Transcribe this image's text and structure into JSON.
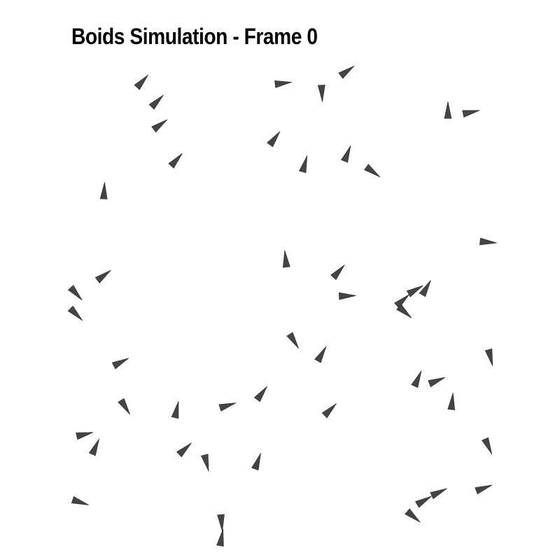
{
  "chart_data": {
    "type": "scatter",
    "title": "Boids Simulation - Frame 0",
    "xlabel": "",
    "ylabel": "",
    "xlim": [
      0,
      100
    ],
    "ylim": [
      0,
      100
    ],
    "axes_visible": false,
    "grid": false,
    "legend": "none",
    "marker": "triangle pointing along heading",
    "marker_color": "#3a3a3a",
    "boids": [
      {
        "x": 17.0,
        "y": 99.0,
        "heading": 48
      },
      {
        "x": 20.5,
        "y": 94.2,
        "heading": 45
      },
      {
        "x": 21.2,
        "y": 88.5,
        "heading": 36
      },
      {
        "x": 25.0,
        "y": 80.0,
        "heading": 48
      },
      {
        "x": 8.0,
        "y": 72.5,
        "heading": 87
      },
      {
        "x": 50.0,
        "y": 98.5,
        "heading": 7
      },
      {
        "x": 59.0,
        "y": 96.0,
        "heading": -87
      },
      {
        "x": 65.0,
        "y": 101.5,
        "heading": 36
      },
      {
        "x": 48.0,
        "y": 85.2,
        "heading": 53
      },
      {
        "x": 55.0,
        "y": 79.0,
        "heading": 74
      },
      {
        "x": 65.0,
        "y": 81.5,
        "heading": 68
      },
      {
        "x": 71.0,
        "y": 77.0,
        "heading": -36
      },
      {
        "x": 88.5,
        "y": 92.0,
        "heading": 90
      },
      {
        "x": 94.0,
        "y": 91.5,
        "heading": 12
      },
      {
        "x": 98.0,
        "y": 60.0,
        "heading": -5
      },
      {
        "x": 50.5,
        "y": 56.0,
        "heading": 96
      },
      {
        "x": 63.0,
        "y": 53.0,
        "heading": 48
      },
      {
        "x": 65.0,
        "y": 47.0,
        "heading": 2
      },
      {
        "x": 78.0,
        "y": 46.0,
        "heading": 42
      },
      {
        "x": 83.5,
        "y": 49.0,
        "heading": 60
      },
      {
        "x": 78.5,
        "y": 43.0,
        "heading": -41
      },
      {
        "x": 81.0,
        "y": 48.5,
        "heading": 30
      },
      {
        "x": 52.5,
        "y": 36.0,
        "heading": -58
      },
      {
        "x": 59.0,
        "y": 33.0,
        "heading": 60
      },
      {
        "x": 98.5,
        "y": 32.0,
        "heading": -76
      },
      {
        "x": 81.5,
        "y": 27.0,
        "heading": 66
      },
      {
        "x": 86.0,
        "y": 26.5,
        "heading": 22
      },
      {
        "x": 89.5,
        "y": 21.5,
        "heading": 84
      },
      {
        "x": 61.0,
        "y": 19.5,
        "heading": 45
      },
      {
        "x": 8.0,
        "y": 52.0,
        "heading": 37
      },
      {
        "x": 1.5,
        "y": 47.5,
        "heading": -48
      },
      {
        "x": 1.5,
        "y": 42.5,
        "heading": -45
      },
      {
        "x": 12.0,
        "y": 31.0,
        "heading": 27
      },
      {
        "x": 13.0,
        "y": 20.0,
        "heading": -58
      },
      {
        "x": 25.0,
        "y": 19.5,
        "heading": 78
      },
      {
        "x": 37.0,
        "y": 20.5,
        "heading": 17
      },
      {
        "x": 45.0,
        "y": 23.5,
        "heading": 53
      },
      {
        "x": 3.5,
        "y": 13.5,
        "heading": 13
      },
      {
        "x": 6.0,
        "y": 10.5,
        "heading": 66
      },
      {
        "x": 27.0,
        "y": 10.0,
        "heading": 43
      },
      {
        "x": 32.0,
        "y": 6.5,
        "heading": -76
      },
      {
        "x": 44.0,
        "y": 7.0,
        "heading": 70
      },
      {
        "x": 2.5,
        "y": -3.0,
        "heading": -18
      },
      {
        "x": 35.5,
        "y": -8.0,
        "heading": -85
      },
      {
        "x": 35.5,
        "y": -11.5,
        "heading": 80
      },
      {
        "x": 80.5,
        "y": -6.5,
        "heading": -40
      },
      {
        "x": 83.0,
        "y": -2.5,
        "heading": 30
      },
      {
        "x": 86.5,
        "y": -0.5,
        "heading": 25
      },
      {
        "x": 97.0,
        "y": 0.5,
        "heading": 20
      },
      {
        "x": 98.0,
        "y": 10.5,
        "heading": -66
      }
    ]
  }
}
